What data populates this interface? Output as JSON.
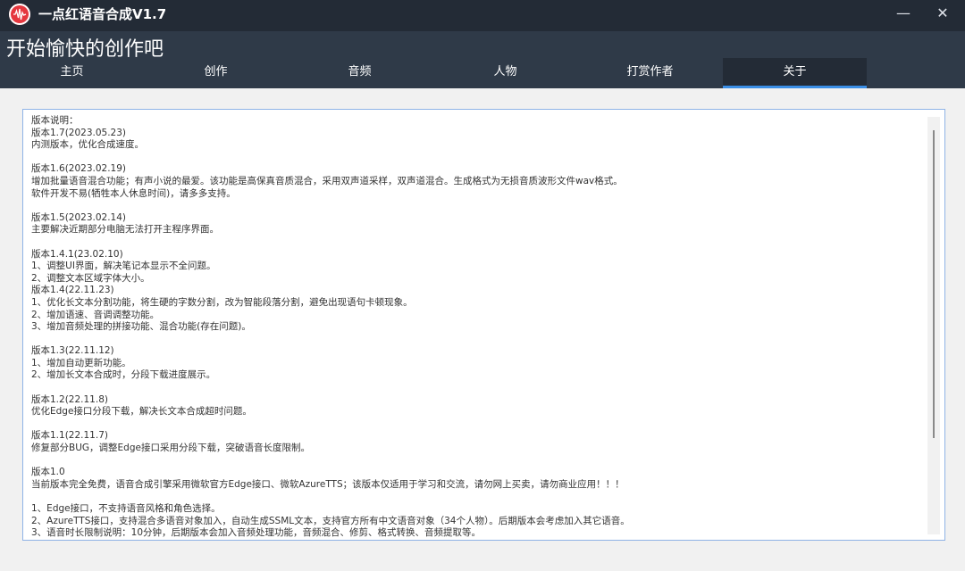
{
  "window": {
    "title": "一点红语音合成V1.7",
    "minimize_label": "—",
    "close_label": "✕",
    "icon": "waveform-icon",
    "colors": {
      "titlebar": "#232b36",
      "header": "#2f3a48",
      "accent": "#3a8ee6",
      "icon_bg": "#e5373f"
    }
  },
  "header": {
    "slogan": "开始愉快的创作吧",
    "tabs": [
      "主页",
      "创作",
      "音频",
      "人物",
      "打赏作者",
      "关于"
    ],
    "active_tab": "关于"
  },
  "about": {
    "lines": [
      "版本说明：",
      "版本1.7(2023.05.23)",
      "内测版本，优化合成速度。",
      "",
      "版本1.6(2023.02.19)",
      "增加批量语音混合功能；有声小说的最爱。该功能是高保真音质混合，采用双声道采样，双声道混合。生成格式为无损音质波形文件wav格式。",
      "软件开发不易(牺牲本人休息时间)，请多多支持。",
      "",
      "版本1.5(2023.02.14)",
      "主要解决近期部分电脑无法打开主程序界面。",
      "",
      "版本1.4.1(23.02.10)",
      "1、调整UI界面，解决笔记本显示不全问题。",
      "2、调整文本区域字体大小。",
      "版本1.4(22.11.23)",
      "1、优化长文本分割功能，将生硬的字数分割，改为智能段落分割，避免出现语句卡顿现象。",
      "2、增加语速、音调调整功能。",
      "3、增加音频处理的拼接功能、混合功能(存在问题)。",
      "",
      "版本1.3(22.11.12)",
      "1、增加自动更新功能。",
      "2、增加长文本合成时，分段下载进度展示。",
      "",
      "版本1.2(22.11.8)",
      "优化Edge接口分段下载，解决长文本合成超时问题。",
      "",
      "版本1.1(22.11.7)",
      "修复部分BUG，调整Edge接口采用分段下载，突破语音长度限制。",
      "",
      "版本1.0",
      "当前版本完全免费，语音合成引擎采用微软官方Edge接口、微软AzureTTS；该版本仅适用于学习和交流，请勿网上买卖，请勿商业应用！！！",
      "",
      "1、Edge接口，不支持语音风格和角色选择。",
      "2、AzureTTS接口，支持混合多语音对象加入，自动生成SSML文本，支持官方所有中文语音对象（34个人物）。后期版本会考虑加入其它语音。",
      "3、语音时长限制说明：10分钟，后期版本会加入音频处理功能，音频混合、修剪、格式转换、音频提取等。"
    ]
  }
}
